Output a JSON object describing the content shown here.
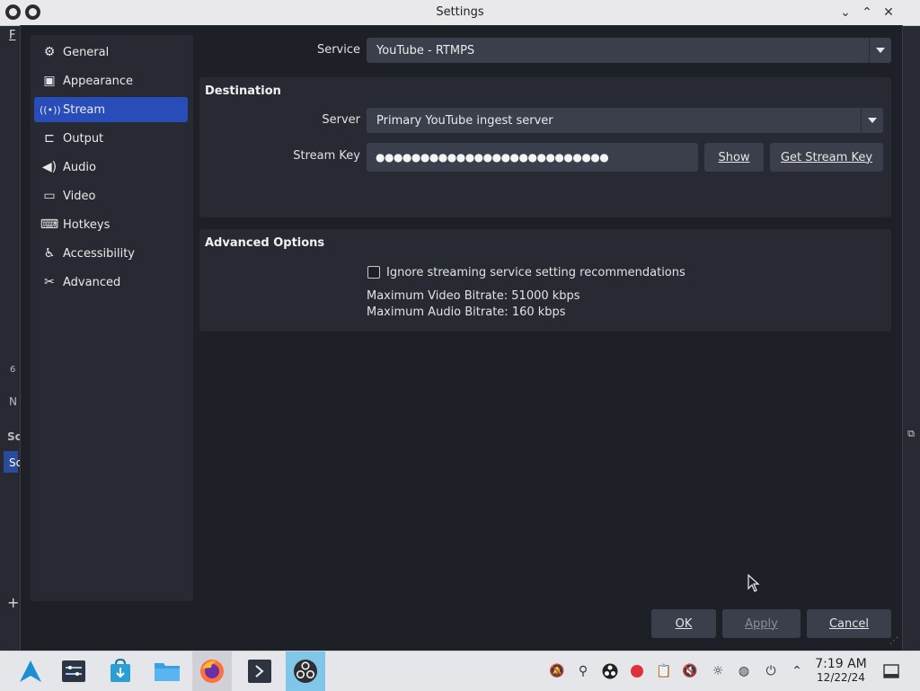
{
  "window": {
    "title": "Settings",
    "controls": [
      "minimize",
      "maximize",
      "close"
    ]
  },
  "background_window": {
    "menu_first_letter": "F",
    "fragments": [
      "6",
      "N",
      "Sc",
      "Sc"
    ]
  },
  "sidebar": {
    "items": [
      {
        "label": "General",
        "icon": "gear-icon",
        "glyph": "⚙"
      },
      {
        "label": "Appearance",
        "icon": "palette-icon",
        "glyph": "▣"
      },
      {
        "label": "Stream",
        "icon": "antenna-icon",
        "glyph": "((•))"
      },
      {
        "label": "Output",
        "icon": "output-icon",
        "glyph": "⊏"
      },
      {
        "label": "Audio",
        "icon": "speaker-icon",
        "glyph": "🔊"
      },
      {
        "label": "Video",
        "icon": "monitor-icon",
        "glyph": "▭"
      },
      {
        "label": "Hotkeys",
        "icon": "keyboard-icon",
        "glyph": "⌨"
      },
      {
        "label": "Accessibility",
        "icon": "accessibility-icon",
        "glyph": "♿"
      },
      {
        "label": "Advanced",
        "icon": "tools-icon",
        "glyph": "✂"
      }
    ],
    "active_index": 2
  },
  "stream": {
    "service_label": "Service",
    "service_value": "YouTube - RTMPS",
    "destination": {
      "title": "Destination",
      "server_label": "Server",
      "server_value": "Primary YouTube ingest server",
      "stream_key_label": "Stream Key",
      "stream_key_value": "●●●●●●●●●●●●●●●●●●●●●●●●●●",
      "show_button": "Show",
      "get_key_button": "Get Stream Key"
    },
    "advanced": {
      "title": "Advanced Options",
      "checkbox_label": "Ignore streaming service setting recommendations",
      "checkbox_checked": false,
      "max_video_bitrate": "Maximum Video Bitrate: 51000 kbps",
      "max_audio_bitrate": "Maximum Audio Bitrate: 160 kbps"
    }
  },
  "footer": {
    "ok": "OK",
    "apply": "Apply",
    "cancel": "Cancel"
  },
  "taskbar": {
    "apps": [
      {
        "name": "app-launcher-icon"
      },
      {
        "name": "system-settings-icon"
      },
      {
        "name": "software-store-icon"
      },
      {
        "name": "file-manager-icon"
      },
      {
        "name": "firefox-icon"
      },
      {
        "name": "terminal-icon"
      },
      {
        "name": "obs-icon"
      }
    ],
    "tray": [
      "notifications-off-icon",
      "network-share-icon",
      "obs-tray-icon",
      "record-icon",
      "clipboard-icon",
      "volume-muted-icon",
      "brightness-icon",
      "network-icon",
      "power-icon",
      "tray-expand-icon"
    ],
    "time": "7:19 AM",
    "date": "12/22/24"
  }
}
